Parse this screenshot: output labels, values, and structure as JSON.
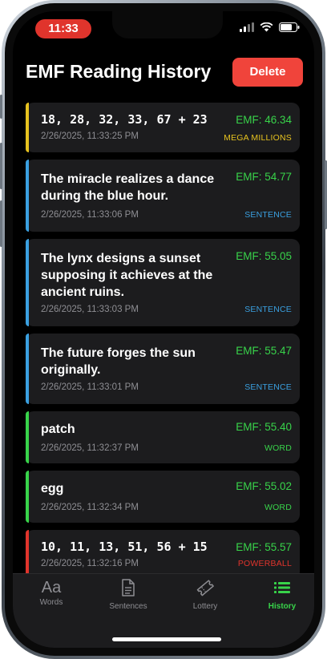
{
  "status_bar": {
    "time": "11:33"
  },
  "header": {
    "title": "EMF Reading History",
    "delete_label": "Delete"
  },
  "entries": [
    {
      "text": "18, 28, 32, 33, 67 + 23",
      "timestamp": "2/26/2025, 11:33:25 PM",
      "emf": "EMF: 46.34",
      "tag": "MEGA MILLIONS",
      "tag_color": "#e6c21f",
      "bar_color": "#e6c21f"
    },
    {
      "text": "The miracle realizes a dance during the blue hour.",
      "timestamp": "2/26/2025, 11:33:06 PM",
      "emf": "EMF: 54.77",
      "tag": "SENTENCE",
      "tag_color": "#3aa0e0",
      "bar_color": "#3aa0e0"
    },
    {
      "text": "The lynx designs a sunset supposing it achieves at the ancient ruins.",
      "timestamp": "2/26/2025, 11:33:03 PM",
      "emf": "EMF: 55.05",
      "tag": "SENTENCE",
      "tag_color": "#3aa0e0",
      "bar_color": "#3aa0e0"
    },
    {
      "text": "The future forges the sun originally.",
      "timestamp": "2/26/2025, 11:33:01 PM",
      "emf": "EMF: 55.47",
      "tag": "SENTENCE",
      "tag_color": "#3aa0e0",
      "bar_color": "#3aa0e0"
    },
    {
      "text": "patch",
      "timestamp": "2/26/2025, 11:32:37 PM",
      "emf": "EMF: 55.40",
      "tag": "WORD",
      "tag_color": "#38d34a",
      "bar_color": "#38d34a"
    },
    {
      "text": "egg",
      "timestamp": "2/26/2025, 11:32:34 PM",
      "emf": "EMF: 55.02",
      "tag": "WORD",
      "tag_color": "#38d34a",
      "bar_color": "#38d34a"
    },
    {
      "text": "10, 11, 13, 51, 56 + 15",
      "timestamp": "2/26/2025, 11:32:16 PM",
      "emf": "EMF: 55.57",
      "tag": "POWERBALL",
      "tag_color": "#e0342c",
      "bar_color": "#e0342c"
    }
  ],
  "tabs": [
    {
      "label": "Words",
      "icon": "text-aa-icon",
      "active": false
    },
    {
      "label": "Sentences",
      "icon": "document-icon",
      "active": false
    },
    {
      "label": "Lottery",
      "icon": "ticket-icon",
      "active": false
    },
    {
      "label": "History",
      "icon": "list-icon",
      "active": true
    }
  ],
  "colors": {
    "accent_green": "#38d34a",
    "delete_red": "#f0443b",
    "inactive_tab": "#8e8e93"
  }
}
